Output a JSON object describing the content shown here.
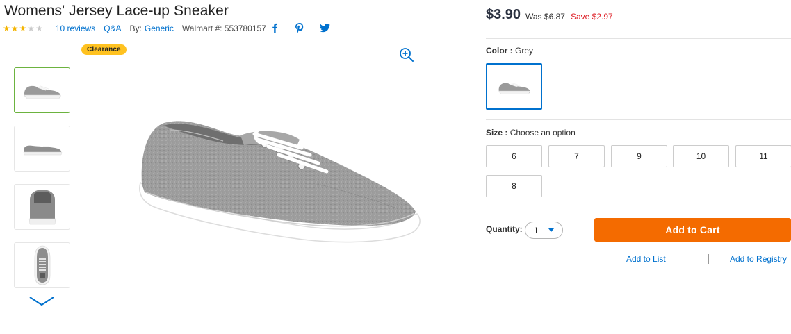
{
  "product": {
    "title": "Womens' Jersey Lace-up Sneaker",
    "rating": 3,
    "rating_max": 5,
    "reviews_label": "10 reviews",
    "qa_label": "Q&A",
    "by_prefix": "By:",
    "brand": "Generic",
    "walmart_number": "Walmart #: 553780157"
  },
  "share_icons": [
    "facebook-icon",
    "pinterest-icon",
    "twitter-icon"
  ],
  "gallery": {
    "badge": "Clearance",
    "thumbnail_count": 4,
    "selected_thumbnail": 1
  },
  "pricing": {
    "price": "$3.90",
    "was": "Was $6.87",
    "save": "Save $2.97"
  },
  "color": {
    "label": "Color :",
    "value": "Grey"
  },
  "size": {
    "label": "Size :",
    "prompt": "Choose an option",
    "options": [
      "6",
      "7",
      "9",
      "10",
      "11",
      "8"
    ]
  },
  "quantity": {
    "label": "Quantity:",
    "value": "1"
  },
  "actions": {
    "add_to_cart": "Add to Cart",
    "add_to_list": "Add to List",
    "add_to_registry": "Add to Registry"
  },
  "colors": {
    "link": "#0071ce",
    "cart": "#f46b00",
    "save": "#de1c24",
    "badge": "#ffc220",
    "selected_thumb": "#6cb33f"
  }
}
